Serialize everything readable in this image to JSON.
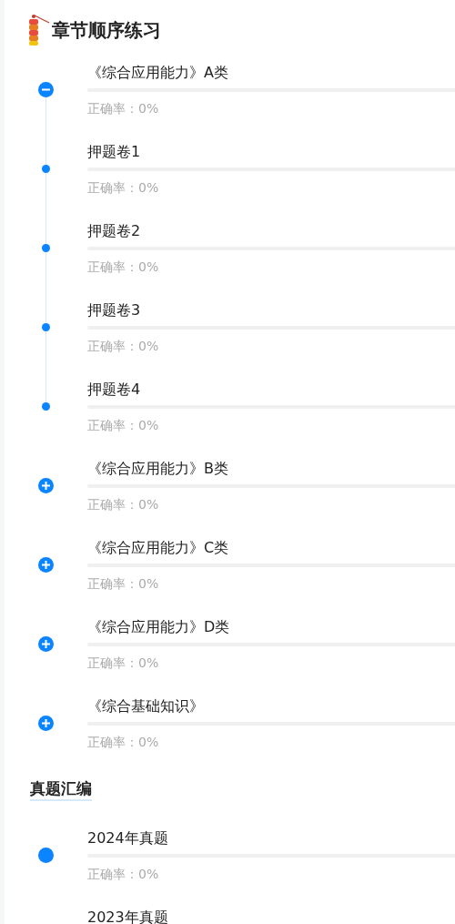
{
  "sections": [
    {
      "title": "章节顺序练习",
      "kind": "chapters",
      "items": [
        {
          "title": "《综合应用能力》A类",
          "accuracy": "正确率：0%",
          "level": 0,
          "expanded": true,
          "children": [
            {
              "title": "押题卷1",
              "accuracy": "正确率：0%",
              "level": 0
            },
            {
              "title": "押题卷2",
              "accuracy": "正确率：0%",
              "level": 0
            },
            {
              "title": "押题卷3",
              "accuracy": "正确率：0%",
              "level": 0
            },
            {
              "title": "押题卷4",
              "accuracy": "正确率：0%",
              "level": 0
            }
          ]
        },
        {
          "title": "《综合应用能力》B类",
          "accuracy": "正确率：0%",
          "level": 0,
          "expanded": false
        },
        {
          "title": "《综合应用能力》C类",
          "accuracy": "正确率：0%",
          "level": 0,
          "expanded": false
        },
        {
          "title": "《综合应用能力》D类",
          "accuracy": "正确率：0%",
          "level": 0,
          "expanded": false
        },
        {
          "title": "《综合基础知识》",
          "accuracy": "正确率：0%",
          "level": 0,
          "expanded": false
        }
      ]
    },
    {
      "title": "真题汇编",
      "kind": "exams",
      "items": [
        {
          "title": "2024年真题",
          "accuracy": "正确率：0%",
          "level": 0
        },
        {
          "title": "2023年真题"
        }
      ]
    }
  ]
}
